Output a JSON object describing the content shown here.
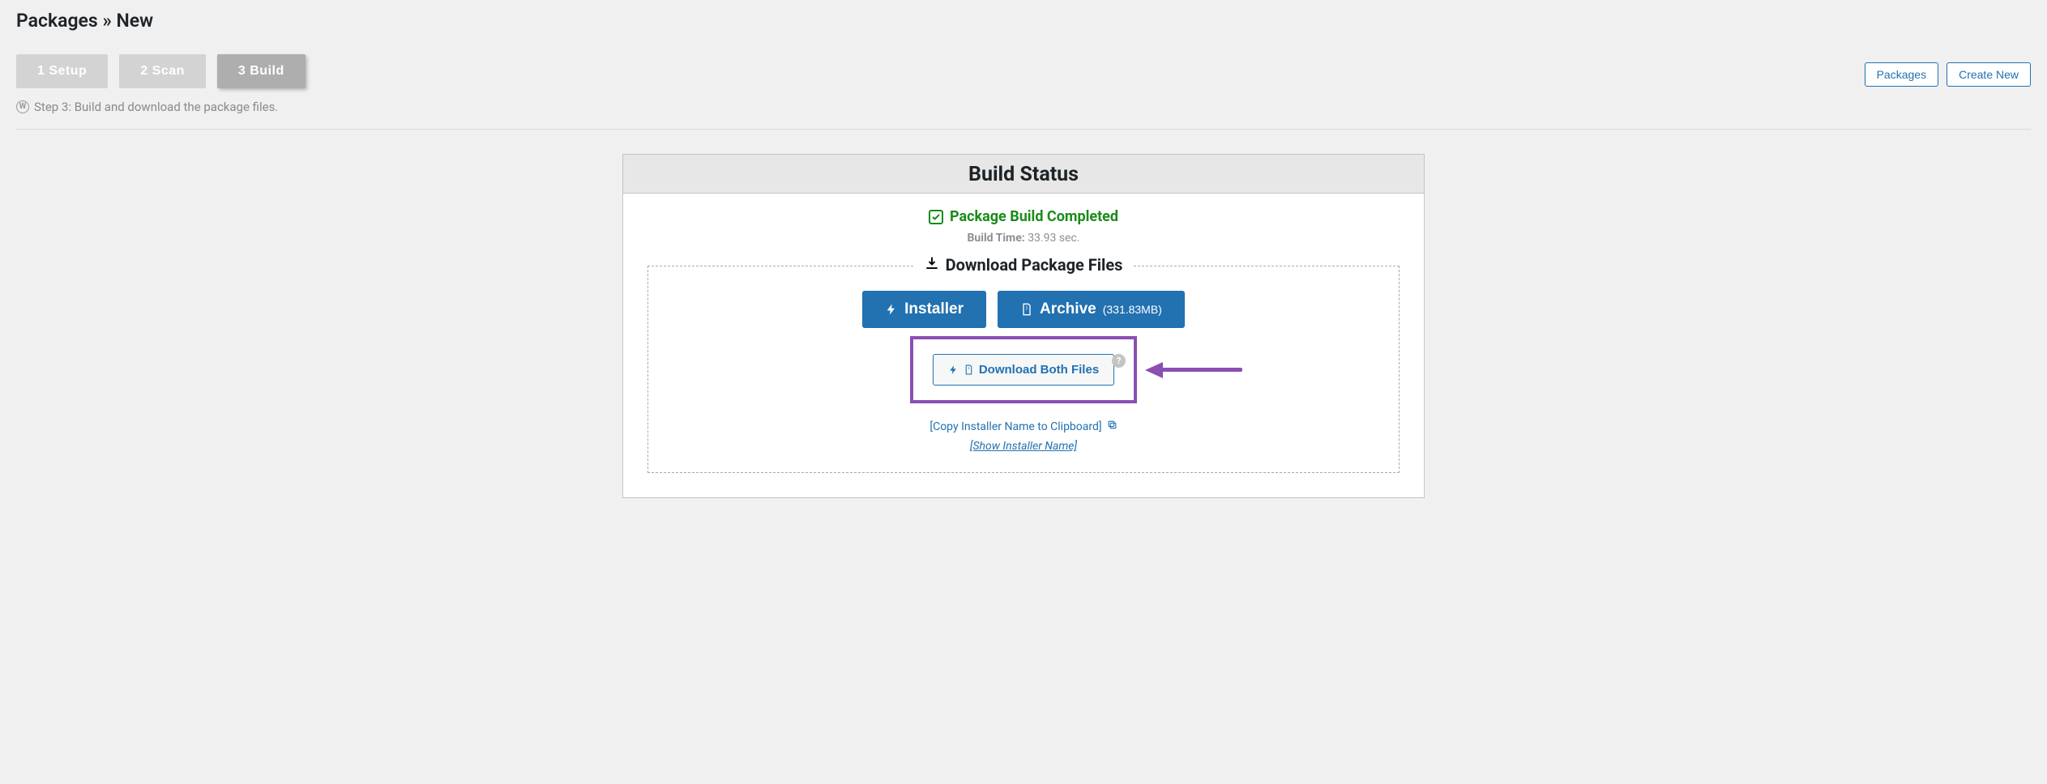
{
  "page": {
    "title": "Packages » New"
  },
  "steps": {
    "setup": "1 Setup",
    "scan": "2 Scan",
    "build": "3 Build"
  },
  "step_desc": "Step 3: Build and download the package files.",
  "top_buttons": {
    "packages": "Packages",
    "create_new": "Create New"
  },
  "panel": {
    "header": "Build Status",
    "status": "Package Build Completed",
    "build_time_label": "Build Time:",
    "build_time_value": "33.93 sec."
  },
  "files": {
    "title": "Download Package Files",
    "installer_label": "Installer",
    "archive_label": "Archive",
    "archive_size": "(331.83MB)",
    "both_label": "Download Both Files",
    "help": "?",
    "copy_text": "[Copy Installer Name to Clipboard]",
    "show_text": "[Show Installer Name]"
  }
}
